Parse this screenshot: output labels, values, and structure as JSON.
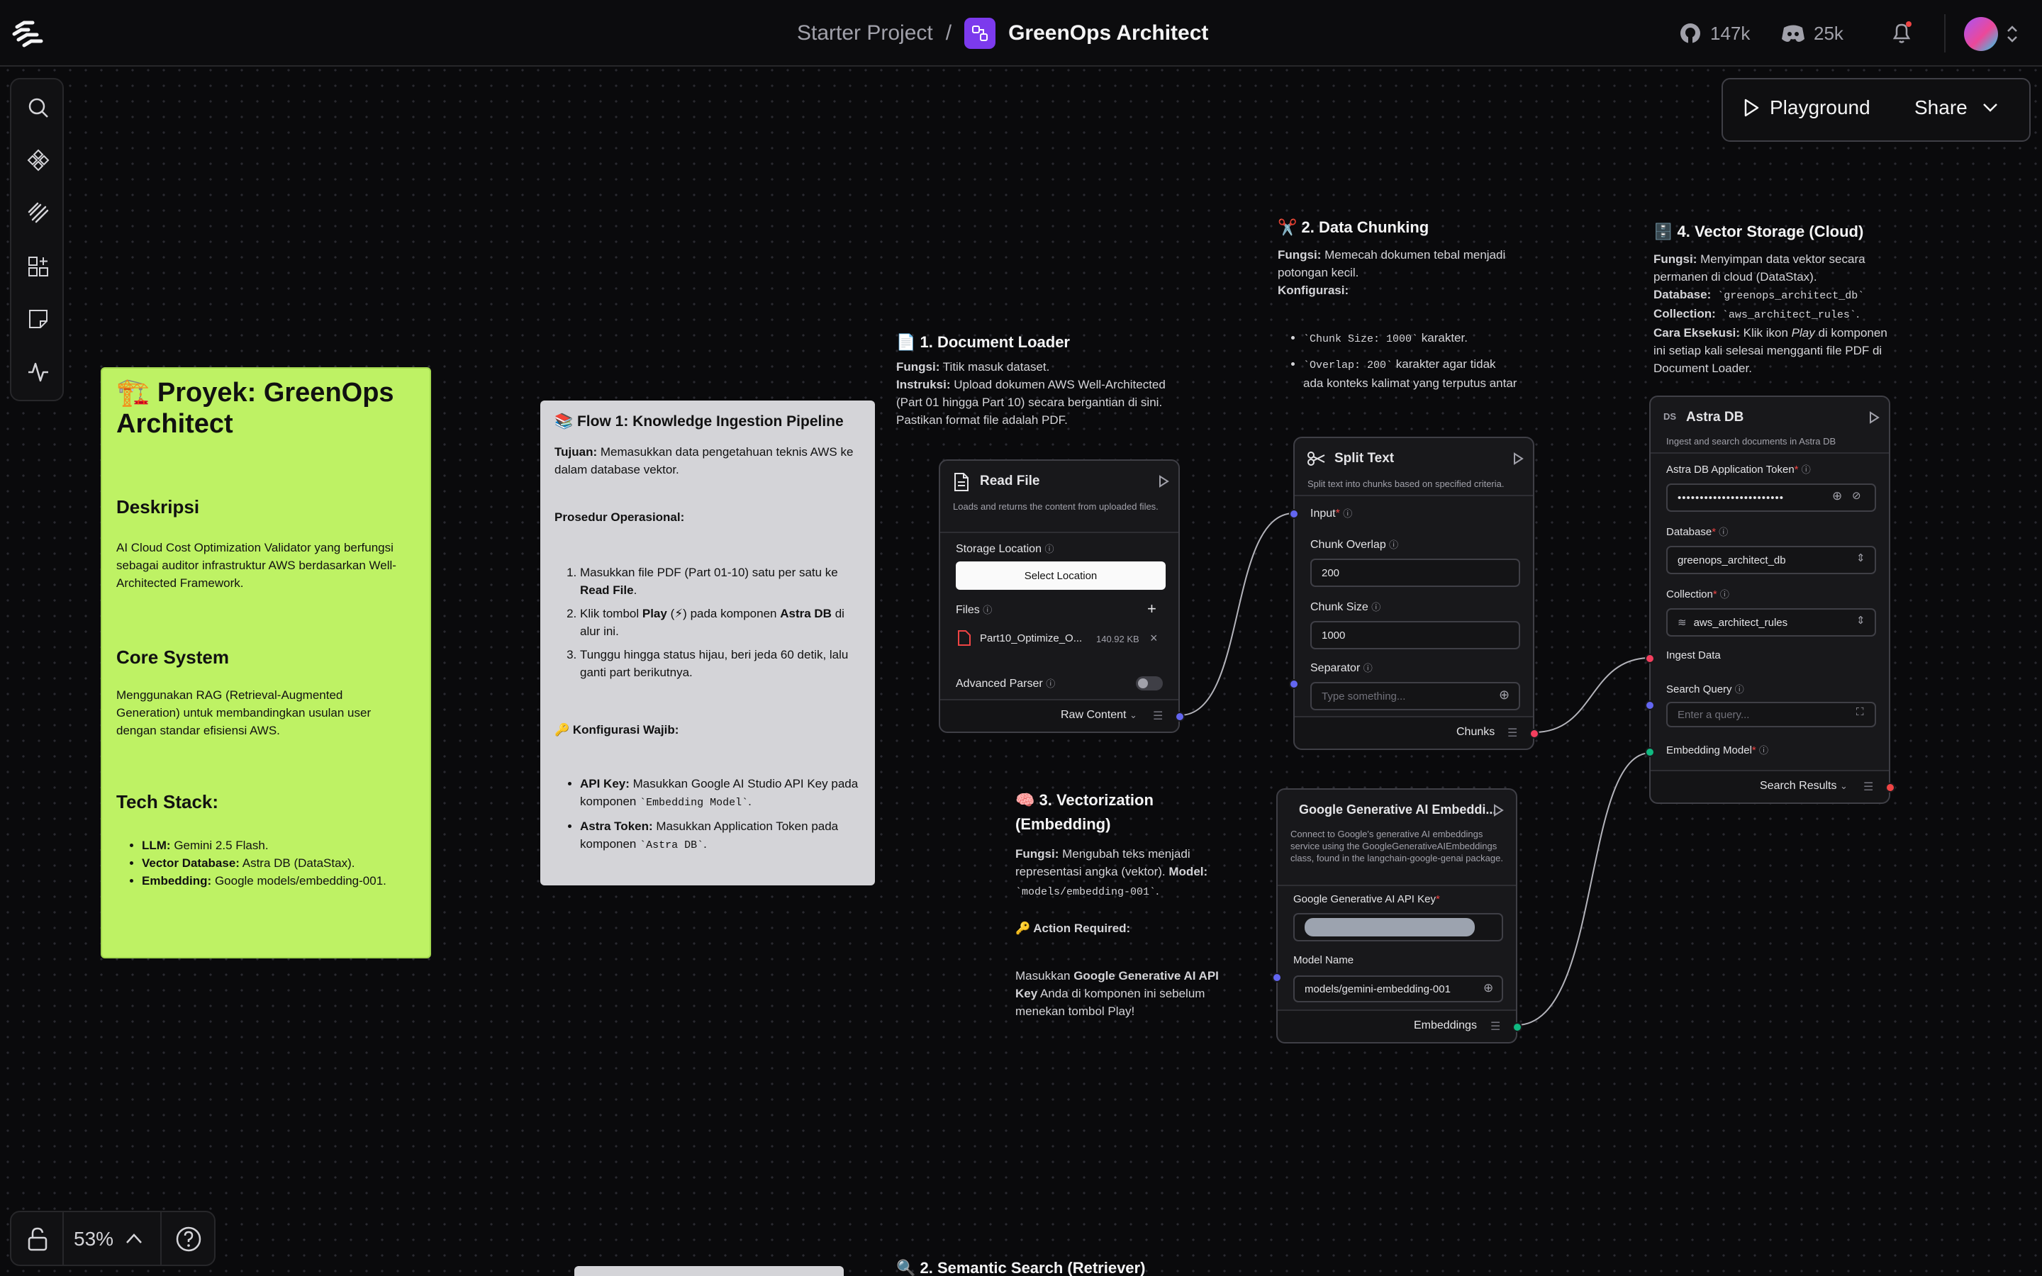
{
  "topbar": {
    "project": "Starter Project",
    "separator": "/",
    "flow_name": "GreenOps Architect",
    "github_count": "147k",
    "discord_count": "25k"
  },
  "toolbar": {
    "playground_label": "Playground",
    "share_label": "Share"
  },
  "zoom": {
    "level": "53%"
  },
  "note_green": {
    "title": "🏗️ Proyek: GreenOps Architect",
    "desc_heading": "Deskripsi",
    "desc_text": "AI Cloud Cost Optimization Validator yang berfungsi sebagai auditor infrastruktur AWS berdasarkan Well-Architected Framework.",
    "core_heading": "Core System",
    "core_text": "Menggunakan RAG (Retrieval-Augmented Generation) untuk membandingkan usulan user dengan standar efisiensi AWS.",
    "tech_heading": "Tech Stack:",
    "tech_items": [
      {
        "key": "LLM:",
        "val": " Gemini 2.5 Flash."
      },
      {
        "key": "Vector Database:",
        "val": " Astra DB (DataStax)."
      },
      {
        "key": "Embedding:",
        "val": " Google models/embedding-001."
      }
    ]
  },
  "note_gray": {
    "title": "📚 Flow 1: Knowledge Ingestion Pipeline",
    "goal_key": "Tujuan:",
    "goal_text": " Memasukkan data pengetahuan teknis AWS ke dalam database vektor.",
    "proc_heading": "Prosedur Operasional:",
    "step1_a": "Masukkan file PDF (Part 01-10) satu per satu ke ",
    "step1_b": "Read File",
    "step1_c": ".",
    "step2_a": "Klik tombol ",
    "step2_b": "Play",
    "step2_c": " (⚡) pada komponen ",
    "step2_d": "Astra DB",
    "step2_e": " di alur ini.",
    "step3": "Tunggu hingga status hijau, beri jeda 60 detik, lalu ganti part berikutnya.",
    "config_heading": "🔑 Konfigurasi Wajib:",
    "cfg1_key": "API Key:",
    "cfg1_text": " Masukkan Google AI Studio API Key pada komponen ",
    "cfg1_code": "`Embedding Model`",
    "cfg1_end": ".",
    "cfg2_key": "Astra Token:",
    "cfg2_text": " Masukkan Application Token pada komponen ",
    "cfg2_code": "`Astra DB`",
    "cfg2_end": "."
  },
  "doc_loader": {
    "title": "📄 1. Document Loader",
    "fungsi_key": "Fungsi:",
    "fungsi": " Titik masuk dataset.",
    "instr_key": "Instruksi:",
    "instr": " Upload dokumen AWS Well-Architected (Part 01 hingga Part 10) secara bergantian di sini. Pastikan format file adalah PDF."
  },
  "chunking": {
    "title": "✂️ 2. Data Chunking",
    "fungsi_key": "Fungsi:",
    "fungsi": " Memecah dokumen tebal menjadi potongan kecil.",
    "konf_key": "Konfigurasi:",
    "item1_code": "`Chunk Size: 1000`",
    "item1_text": " karakter.",
    "item2_code": "`Overlap: 200`",
    "item2_text": " karakter agar tidak ada konteks kalimat yang terputus antar"
  },
  "vector_storage": {
    "title": "🗄️ 4. Vector Storage (Cloud)",
    "fungsi_key": "Fungsi:",
    "fungsi": " Menyimpan data vektor secara permanen di cloud (DataStax).",
    "db_key": "Database:",
    "db_code": " `greenops_architect_db`",
    "col_key": "Collection:",
    "col_code": " `aws_architect_rules`",
    "col_end": ".",
    "exec_key": "Cara Eksekusi:",
    "exec_a": " Klik ikon ",
    "exec_b": "Play",
    "exec_c": " di komponen ini setiap kali selesai mengganti file PDF di Document Loader."
  },
  "vectorization": {
    "title": "🧠 3. Vectorization (Embedding)",
    "fungsi_key": "Fungsi:",
    "fungsi": " Mengubah teks menjadi representasi angka (vektor). ",
    "model_key": "Model:",
    "model_code": " `models/embedding-001`",
    "model_end": ".",
    "action": "🔑 Action Required:",
    "body_a": "Masukkan ",
    "body_b": "Google Generative AI API Key",
    "body_c": " Anda di komponen ini sebelum menekan tombol Play!"
  },
  "semantic_search": {
    "title": "🔍 2. Semantic Search (Retriever)"
  },
  "read_file": {
    "title": "Read File",
    "desc": "Loads and returns the content from uploaded files.",
    "storage_label": "Storage Location",
    "select_btn": "Select Location",
    "files_label": "Files",
    "file_name": "Part10_Optimize_O...",
    "file_size": "140.92 KB",
    "adv_label": "Advanced Parser",
    "output": "Raw Content"
  },
  "split_text": {
    "title": "Split Text",
    "desc": "Split text into chunks based on specified criteria.",
    "input_label": "Input",
    "overlap_label": "Chunk Overlap",
    "overlap_val": "200",
    "size_label": "Chunk Size",
    "size_val": "1000",
    "sep_label": "Separator",
    "sep_ph": "Type something...",
    "output": "Chunks"
  },
  "astra": {
    "title": "Astra DB",
    "desc": "Ingest and search documents in Astra DB",
    "token_label": "Astra DB Application Token",
    "token_val": "••••••••••••••••••••••••",
    "db_label": "Database",
    "db_val": "greenops_architect_db",
    "col_label": "Collection",
    "col_val": "aws_architect_rules",
    "ingest_label": "Ingest Data",
    "search_label": "Search Query",
    "search_ph": "Enter a query...",
    "embed_label": "Embedding Model",
    "output": "Search Results"
  },
  "google_embed": {
    "title": "Google Generative AI Embeddi...",
    "desc": "Connect to Google's generative AI embeddings service using the GoogleGenerativeAIEmbeddings class, found in the langchain-google-genai package.",
    "key_label": "Google Generative AI API Key",
    "model_label": "Model Name",
    "model_val": "models/gemini-embedding-001",
    "output": "Embeddings"
  }
}
